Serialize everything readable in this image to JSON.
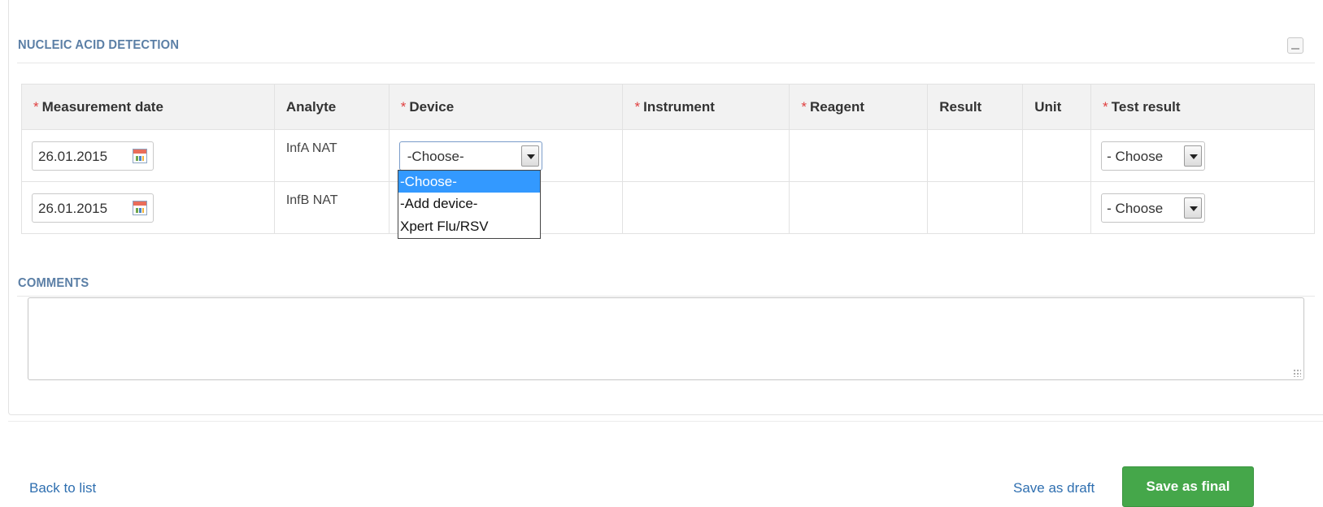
{
  "nucleic_section": {
    "title": "NUCLEIC ACID DETECTION",
    "required_marker": "*",
    "columns": {
      "measurement_date": "Measurement date",
      "analyte": "Analyte",
      "device": "Device",
      "instrument": "Instrument",
      "reagent": "Reagent",
      "result": "Result",
      "unit": "Unit",
      "test_result": "Test result"
    },
    "rows": [
      {
        "date": "26.01.2015",
        "analyte": "InfA NAT",
        "device": "-Choose-",
        "test_result": "- Choose"
      },
      {
        "date": "26.01.2015",
        "analyte": "InfB NAT",
        "device": "",
        "test_result": "- Choose"
      }
    ],
    "device_dropdown": {
      "options": [
        "-Choose-",
        "-Add device-",
        "Xpert Flu/RSV"
      ],
      "highlighted": "-Choose-"
    }
  },
  "comments_section": {
    "title": "COMMENTS",
    "value": ""
  },
  "footer": {
    "back_label": "Back to list",
    "draft_label": "Save as draft",
    "final_label": "Save as final"
  }
}
